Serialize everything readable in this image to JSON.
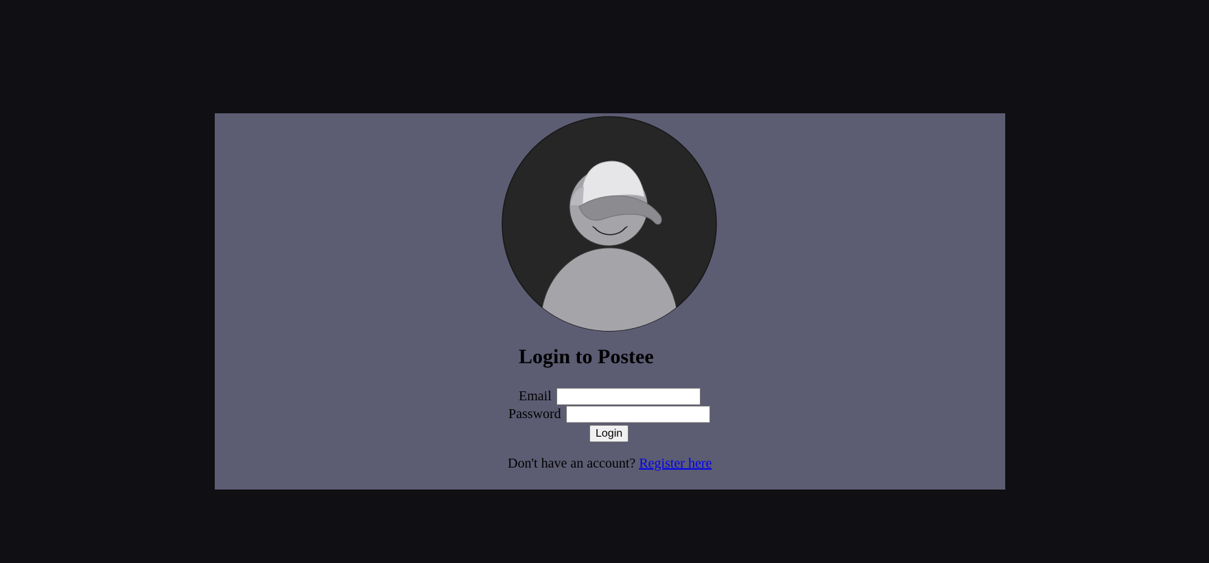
{
  "login": {
    "title": "Login to Postee",
    "email_label": "Email",
    "email_value": "",
    "password_label": "Password",
    "password_value": "",
    "submit_label": "Login"
  },
  "register": {
    "prompt": "Don't have an account?",
    "link_label": "Register here"
  },
  "colors": {
    "page_background": "#0f0f14",
    "card_background": "#5c5c73",
    "avatar_background": "#262626",
    "avatar_figure": "#a5a4a8",
    "link": "#0000ee"
  },
  "icons": {
    "avatar": "user-avatar-with-cap"
  }
}
